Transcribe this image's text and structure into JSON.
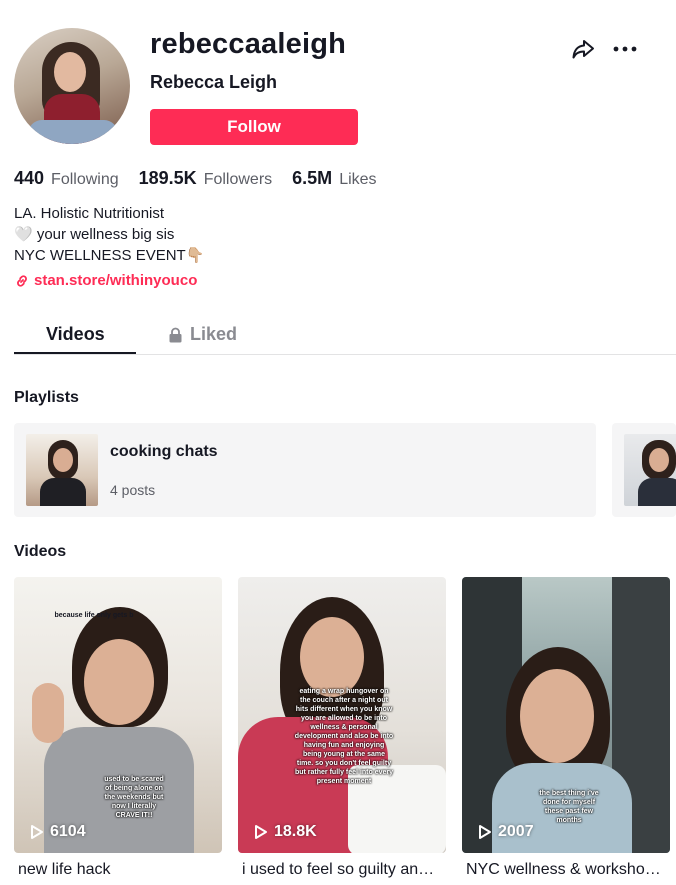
{
  "profile": {
    "username": "rebeccaaleigh",
    "nickname": "Rebecca Leigh",
    "follow_label": "Follow",
    "share_icon": "share-icon",
    "more_icon": "more-options-icon"
  },
  "stats": [
    {
      "num": "440",
      "label": "Following"
    },
    {
      "num": "189.5K",
      "label": "Followers"
    },
    {
      "num": "6.5M",
      "label": "Likes"
    }
  ],
  "bio": {
    "line1": "LA. Holistic Nutritionist",
    "line2": "🤍 your wellness big sis",
    "line3": "NYC WELLNESS EVENT👇🏼",
    "link": "stan.store/withinyouco"
  },
  "tabs": {
    "videos": "Videos",
    "liked": "Liked"
  },
  "playlists": {
    "title": "Playlists",
    "items": [
      {
        "title": "cooking chats",
        "count": "4 posts"
      }
    ]
  },
  "videos": {
    "title": "Videos",
    "items": [
      {
        "views": "6104",
        "desc": "new life hack",
        "overlay_top": "because life only gets b",
        "overlay_bottom": "used to be scared of being alone on the weekends but now I literally CRAVE IT!!"
      },
      {
        "views": "18.8K",
        "desc": "i used to feel so guilty and ashamed",
        "overlay": "eating a wrap hungover on the couch after a night out hits different when you know you are allowed to be into wellness & personal development and also be into having fun and enjoying being young at the same time. so you don't feel guilty but rather fully feel into every present moment"
      },
      {
        "views": "2007",
        "desc": "NYC wellness & workshop event",
        "overlay": "the best thing i've done for myself these past few months"
      }
    ]
  },
  "colors": {
    "accent": "#fe2c55",
    "text": "#161823",
    "muted": "#5c5e66"
  }
}
